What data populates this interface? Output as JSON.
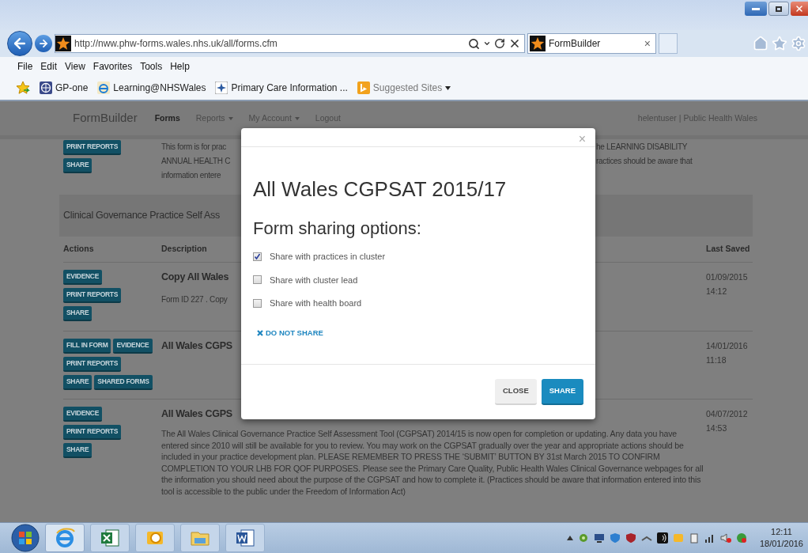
{
  "browser": {
    "url": "http://nww.phw-forms.wales.nhs.uk/all/forms.cfm",
    "tab": {
      "title": "FormBuilder",
      "close": "×"
    },
    "menu": [
      "File",
      "Edit",
      "View",
      "Favorites",
      "Tools",
      "Help"
    ],
    "favorites": [
      {
        "label": "GP-one",
        "kind": "gp"
      },
      {
        "label": "Learning@NHSWales",
        "kind": "ie"
      },
      {
        "label": "Primary Care Information ...",
        "kind": "compass"
      },
      {
        "label": "Suggested Sites",
        "kind": "suggested"
      }
    ]
  },
  "nav": {
    "brand": "FormBuilder",
    "items": [
      {
        "label": "Forms",
        "selected": true,
        "dropdown": false
      },
      {
        "label": "Reports",
        "selected": false,
        "dropdown": true
      },
      {
        "label": "My Account",
        "selected": false,
        "dropdown": true
      },
      {
        "label": "Logout",
        "selected": false,
        "dropdown": false
      }
    ],
    "user": "helentuser | Public Health Wales"
  },
  "top_row": {
    "buttons": [
      [
        "PRINT REPORTS"
      ],
      [
        "SHARE"
      ]
    ],
    "lines": [
      {
        "left": "This form is for prac",
        "right": "he LEARNING DISABILITY"
      },
      {
        "left": "ANNUAL HEALTH C",
        "right": "ractices should be aware that"
      },
      {
        "left": "information entere"
      }
    ]
  },
  "section_title": "Clinical Governance Practice Self Ass",
  "table": {
    "columns": [
      "Actions",
      "Description",
      "Last Saved"
    ],
    "rows": [
      {
        "buttons": [
          [
            "EVIDENCE"
          ],
          [
            "PRINT REPORTS"
          ],
          [
            "SHARE"
          ]
        ],
        "title": "Copy All Wales",
        "description": "Form ID 227 . Copy",
        "date": "01/09/2015",
        "time": "14:12"
      },
      {
        "buttons": [
          [
            "FILL IN FORM",
            "EVIDENCE"
          ],
          [
            "PRINT REPORTS"
          ],
          [
            "SHARE",
            "SHARED FORMS"
          ]
        ],
        "title": "All Wales CGPS",
        "date": "14/01/2016",
        "time": "11:18"
      },
      {
        "buttons": [
          [
            "EVIDENCE"
          ],
          [
            "PRINT REPORTS"
          ],
          [
            "SHARE"
          ]
        ],
        "title": "All Wales CGPS",
        "paragraph": "The All Wales Clinical Governance Practice Self Assessment Tool (CGPSAT) 2014/15 is now open for completion or updating. Any data you have entered since 2010 will still be available for you to review. You may work on the CGPSAT gradually over the year and appropriate actions should be included in your practice development plan. PLEASE REMEMBER TO PRESS THE ‘SUBMIT’ BUTTON BY 31st March 2015 TO CONFIRM COMPLETION TO YOUR LHB FOR QOF PURPOSES. Please see the Primary Care Quality, Public Health Wales Clinical Governance webpages for all the information you should need about the purpose of the CGPSAT and how to complete it. (Practices should be aware that information entered into this tool is accessible to the public under the Freedom of Information Act)",
        "date": "04/07/2012",
        "time": "14:53"
      }
    ]
  },
  "modal": {
    "close": "×",
    "title": "All Wales CGPSAT 2015/17",
    "subtitle": "Form sharing options:",
    "options": [
      {
        "label": "Share with practices in cluster",
        "checked": true
      },
      {
        "label": "Share with cluster lead",
        "checked": false
      },
      {
        "label": "Share with health board",
        "checked": false
      }
    ],
    "no_share": "DO NOT SHARE",
    "buttons": [
      {
        "label": "CLOSE",
        "kind": "default"
      },
      {
        "label": "SHARE",
        "kind": "primary"
      }
    ]
  },
  "taskbar": {
    "time": "12:11",
    "date": "18/01/2016"
  }
}
